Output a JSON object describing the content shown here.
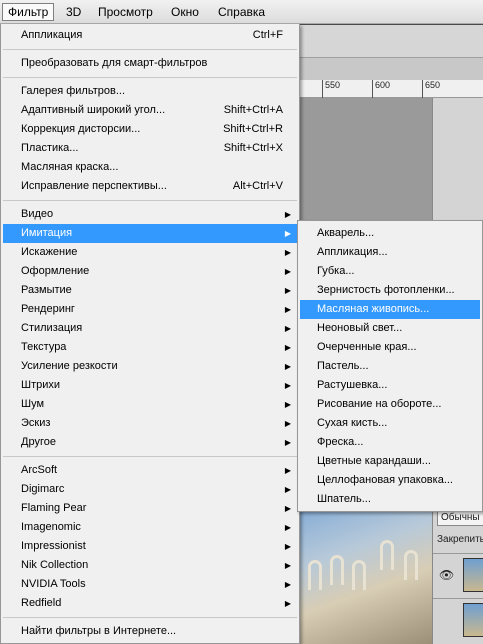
{
  "menubar": {
    "items": [
      "Фильтр",
      "3D",
      "Просмотр",
      "Окно",
      "Справка"
    ]
  },
  "ruler": {
    "ticks": [
      "550",
      "600",
      "650"
    ]
  },
  "layers_panel": {
    "blend_mode": "Обычны",
    "lock_label": "Закрепить"
  },
  "filter_menu": {
    "last_filter": {
      "label": "Аппликация",
      "shortcut": "Ctrl+F"
    },
    "convert_smart": "Преобразовать для смарт-фильтров",
    "group1": [
      {
        "label": "Галерея фильтров...",
        "shortcut": ""
      },
      {
        "label": "Адаптивный широкий угол...",
        "shortcut": "Shift+Ctrl+A"
      },
      {
        "label": "Коррекция дисторсии...",
        "shortcut": "Shift+Ctrl+R"
      },
      {
        "label": "Пластика...",
        "shortcut": "Shift+Ctrl+X"
      },
      {
        "label": "Масляная краска...",
        "shortcut": ""
      },
      {
        "label": "Исправление перспективы...",
        "shortcut": "Alt+Ctrl+V"
      }
    ],
    "group2": [
      "Видео",
      "Имитация",
      "Искажение",
      "Оформление",
      "Размытие",
      "Рендеринг",
      "Стилизация",
      "Текстура",
      "Усиление резкости",
      "Штрихи",
      "Шум",
      "Эскиз",
      "Другое"
    ],
    "group2_highlighted": "Имитация",
    "group3": [
      "ArcSoft",
      "Digimarc",
      "Flaming Pear",
      "Imagenomic",
      "Impressionist",
      "Nik Collection",
      "NVIDIA Tools",
      "Redfield"
    ],
    "browse_online": "Найти фильтры в Интернете..."
  },
  "artistic_submenu": {
    "items": [
      "Акварель...",
      "Аппликация...",
      "Губка...",
      "Зернистость фотопленки...",
      "Масляная живопись...",
      "Неоновый свет...",
      "Очерченные края...",
      "Пастель...",
      "Растушевка...",
      "Рисование на обороте...",
      "Сухая кисть...",
      "Фреска...",
      "Цветные карандаши...",
      "Целлофановая упаковка...",
      "Шпатель..."
    ],
    "highlighted": "Масляная живопись..."
  },
  "colors": {
    "highlight": "#3399ff",
    "menu_bg": "#f0f0f0"
  }
}
